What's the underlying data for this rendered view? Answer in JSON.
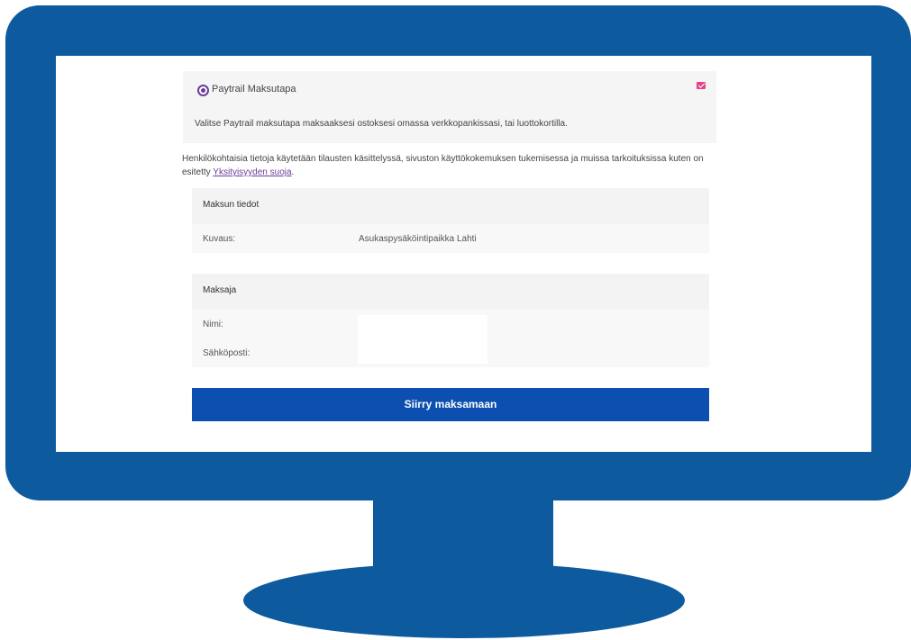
{
  "payment_method": {
    "label": "Paytrail Maksutapa",
    "description": "Valitse Paytrail maksutapa maksaaksesi ostoksesi omassa verkkopankissasi, tai luottokortilla."
  },
  "privacy": {
    "text": "Henkilökohtaisia tietoja käytetään tilausten käsittelyssä, sivuston käyttökokemuksen tukemisessa ja muissa tarkoituksissa kuten on esitetty ",
    "link": "Yksityisyyden suoja",
    "suffix": "."
  },
  "payment_details": {
    "title": "Maksun tiedot",
    "description_label": "Kuvaus:",
    "description_value": "Asukaspysäköintipaikka Lahti"
  },
  "payer": {
    "title": "Maksaja",
    "name_label": "Nimi:",
    "email_label": "Sähköposti:"
  },
  "pay_button": "Siirry maksamaan",
  "colors": {
    "monitor": "#0d5a9e",
    "button": "#0d4fb0",
    "accent_purple": "#6a3d9a",
    "icon_pink": "#e83e8c"
  },
  "icons": {
    "radio": "radio-selected-icon",
    "method_icon": "mail-icon"
  }
}
